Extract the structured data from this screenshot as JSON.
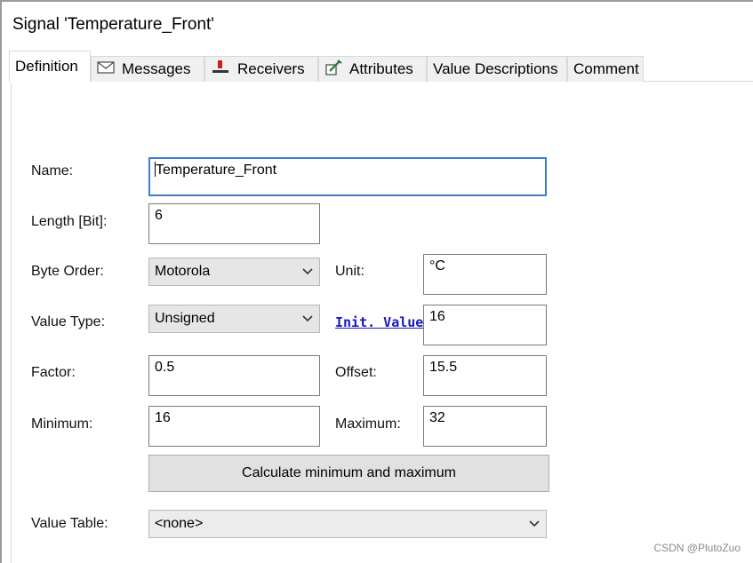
{
  "window": {
    "title": "Signal 'Temperature_Front'"
  },
  "tabs": [
    {
      "label": "Definition",
      "icon": ""
    },
    {
      "label": "Messages",
      "icon": "envelope-icon"
    },
    {
      "label": "Receivers",
      "icon": "receiver-node-icon"
    },
    {
      "label": "Attributes",
      "icon": "edit-attribute-icon"
    },
    {
      "label": "Value Descriptions",
      "icon": ""
    },
    {
      "label": "Comment",
      "icon": ""
    }
  ],
  "form": {
    "name": {
      "label": "Name:",
      "value": "Temperature_Front"
    },
    "length": {
      "label": "Length [Bit]:",
      "value": "6"
    },
    "byte_order": {
      "label": "Byte Order:",
      "value": "Motorola"
    },
    "unit": {
      "label": "Unit:",
      "value": "°C"
    },
    "value_type": {
      "label": "Value Type:",
      "value": "Unsigned"
    },
    "init_value": {
      "label": "Init. Value",
      "value": "16"
    },
    "factor": {
      "label": "Factor:",
      "value": "0.5"
    },
    "offset": {
      "label": "Offset:",
      "value": "15.5"
    },
    "minimum": {
      "label": "Minimum:",
      "value": "16"
    },
    "maximum": {
      "label": "Maximum:",
      "value": "32"
    },
    "calc_button": "Calculate minimum and maximum",
    "value_table": {
      "label": "Value Table:",
      "value": "<none>"
    }
  },
  "watermark": "CSDN @PlutoZuo",
  "colors": {
    "link": "#1a1ab8",
    "focus_border": "#3d7ec7",
    "combo_bg": "#e6e6e6",
    "button_bg": "#e1e1e1"
  }
}
